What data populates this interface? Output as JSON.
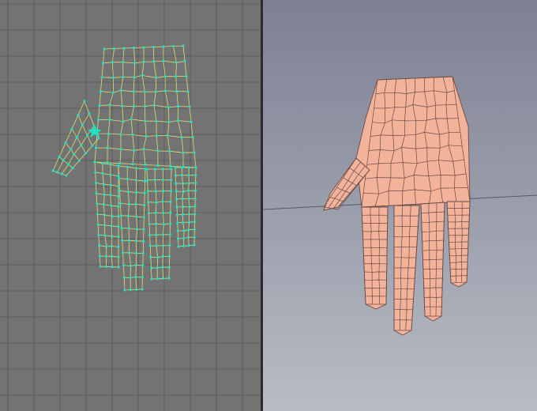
{
  "layout": {
    "viewports": [
      {
        "id": "top",
        "label": "",
        "mode": "wireframe",
        "background": "#737373",
        "grid_color": "#5e5e5e",
        "grid_strong_color": "#4f4f4f",
        "wire_color": "#d8e26a",
        "vertex_color": "#1fe0c8"
      },
      {
        "id": "perspective",
        "label": "",
        "mode": "shaded",
        "background_top": "#7c8092",
        "background_bottom": "#b8bcc5",
        "surface_color": "#f2b39a",
        "edge_color": "#6b4b46",
        "ground_line_color": "#555a64"
      }
    ]
  },
  "scene": {
    "object": "hand-mesh",
    "selected_vertex_count": "",
    "status": ""
  }
}
